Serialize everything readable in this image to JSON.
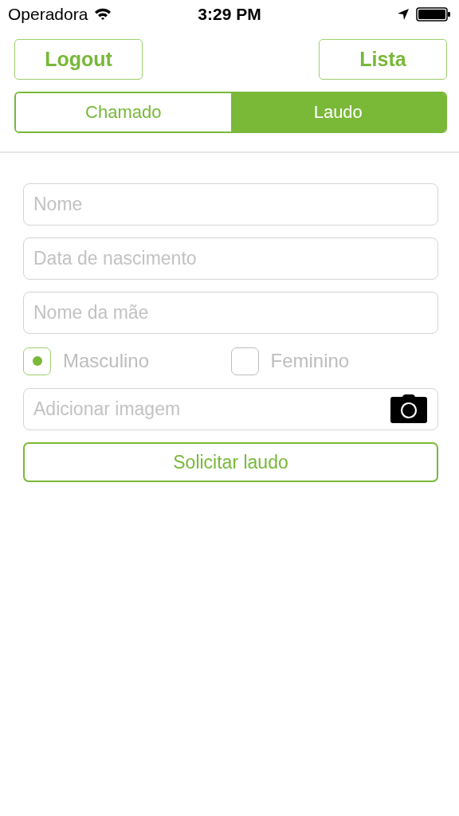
{
  "status_bar": {
    "carrier": "Operadora",
    "time": "3:29 PM"
  },
  "nav_buttons": [
    "Logout",
    "Lista"
  ],
  "tabs": [
    {
      "label": "Chamado",
      "selected": false
    },
    {
      "label": "Laudo",
      "selected": true
    }
  ],
  "fields": [
    {
      "placeholder": "Nome"
    },
    {
      "placeholder": "Data de nascimento"
    },
    {
      "placeholder": "Nome da mãe"
    }
  ],
  "sex_options": [
    {
      "label": "Masculino",
      "selected": true
    },
    {
      "label": "Feminino",
      "selected": false
    }
  ],
  "image_field": {
    "placeholder": "Adicionar imagem"
  },
  "submit_button": "Solicitar laudo"
}
